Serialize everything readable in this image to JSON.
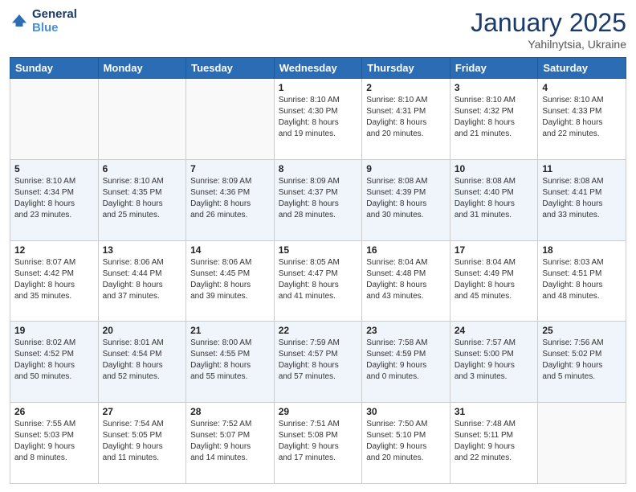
{
  "header": {
    "logo_line1": "General",
    "logo_line2": "Blue",
    "month": "January 2025",
    "location": "Yahilnytsia, Ukraine"
  },
  "weekdays": [
    "Sunday",
    "Monday",
    "Tuesday",
    "Wednesday",
    "Thursday",
    "Friday",
    "Saturday"
  ],
  "weeks": [
    [
      {
        "day": "",
        "info": ""
      },
      {
        "day": "",
        "info": ""
      },
      {
        "day": "",
        "info": ""
      },
      {
        "day": "1",
        "info": "Sunrise: 8:10 AM\nSunset: 4:30 PM\nDaylight: 8 hours\nand 19 minutes."
      },
      {
        "day": "2",
        "info": "Sunrise: 8:10 AM\nSunset: 4:31 PM\nDaylight: 8 hours\nand 20 minutes."
      },
      {
        "day": "3",
        "info": "Sunrise: 8:10 AM\nSunset: 4:32 PM\nDaylight: 8 hours\nand 21 minutes."
      },
      {
        "day": "4",
        "info": "Sunrise: 8:10 AM\nSunset: 4:33 PM\nDaylight: 8 hours\nand 22 minutes."
      }
    ],
    [
      {
        "day": "5",
        "info": "Sunrise: 8:10 AM\nSunset: 4:34 PM\nDaylight: 8 hours\nand 23 minutes."
      },
      {
        "day": "6",
        "info": "Sunrise: 8:10 AM\nSunset: 4:35 PM\nDaylight: 8 hours\nand 25 minutes."
      },
      {
        "day": "7",
        "info": "Sunrise: 8:09 AM\nSunset: 4:36 PM\nDaylight: 8 hours\nand 26 minutes."
      },
      {
        "day": "8",
        "info": "Sunrise: 8:09 AM\nSunset: 4:37 PM\nDaylight: 8 hours\nand 28 minutes."
      },
      {
        "day": "9",
        "info": "Sunrise: 8:08 AM\nSunset: 4:39 PM\nDaylight: 8 hours\nand 30 minutes."
      },
      {
        "day": "10",
        "info": "Sunrise: 8:08 AM\nSunset: 4:40 PM\nDaylight: 8 hours\nand 31 minutes."
      },
      {
        "day": "11",
        "info": "Sunrise: 8:08 AM\nSunset: 4:41 PM\nDaylight: 8 hours\nand 33 minutes."
      }
    ],
    [
      {
        "day": "12",
        "info": "Sunrise: 8:07 AM\nSunset: 4:42 PM\nDaylight: 8 hours\nand 35 minutes."
      },
      {
        "day": "13",
        "info": "Sunrise: 8:06 AM\nSunset: 4:44 PM\nDaylight: 8 hours\nand 37 minutes."
      },
      {
        "day": "14",
        "info": "Sunrise: 8:06 AM\nSunset: 4:45 PM\nDaylight: 8 hours\nand 39 minutes."
      },
      {
        "day": "15",
        "info": "Sunrise: 8:05 AM\nSunset: 4:47 PM\nDaylight: 8 hours\nand 41 minutes."
      },
      {
        "day": "16",
        "info": "Sunrise: 8:04 AM\nSunset: 4:48 PM\nDaylight: 8 hours\nand 43 minutes."
      },
      {
        "day": "17",
        "info": "Sunrise: 8:04 AM\nSunset: 4:49 PM\nDaylight: 8 hours\nand 45 minutes."
      },
      {
        "day": "18",
        "info": "Sunrise: 8:03 AM\nSunset: 4:51 PM\nDaylight: 8 hours\nand 48 minutes."
      }
    ],
    [
      {
        "day": "19",
        "info": "Sunrise: 8:02 AM\nSunset: 4:52 PM\nDaylight: 8 hours\nand 50 minutes."
      },
      {
        "day": "20",
        "info": "Sunrise: 8:01 AM\nSunset: 4:54 PM\nDaylight: 8 hours\nand 52 minutes."
      },
      {
        "day": "21",
        "info": "Sunrise: 8:00 AM\nSunset: 4:55 PM\nDaylight: 8 hours\nand 55 minutes."
      },
      {
        "day": "22",
        "info": "Sunrise: 7:59 AM\nSunset: 4:57 PM\nDaylight: 8 hours\nand 57 minutes."
      },
      {
        "day": "23",
        "info": "Sunrise: 7:58 AM\nSunset: 4:59 PM\nDaylight: 9 hours\nand 0 minutes."
      },
      {
        "day": "24",
        "info": "Sunrise: 7:57 AM\nSunset: 5:00 PM\nDaylight: 9 hours\nand 3 minutes."
      },
      {
        "day": "25",
        "info": "Sunrise: 7:56 AM\nSunset: 5:02 PM\nDaylight: 9 hours\nand 5 minutes."
      }
    ],
    [
      {
        "day": "26",
        "info": "Sunrise: 7:55 AM\nSunset: 5:03 PM\nDaylight: 9 hours\nand 8 minutes."
      },
      {
        "day": "27",
        "info": "Sunrise: 7:54 AM\nSunset: 5:05 PM\nDaylight: 9 hours\nand 11 minutes."
      },
      {
        "day": "28",
        "info": "Sunrise: 7:52 AM\nSunset: 5:07 PM\nDaylight: 9 hours\nand 14 minutes."
      },
      {
        "day": "29",
        "info": "Sunrise: 7:51 AM\nSunset: 5:08 PM\nDaylight: 9 hours\nand 17 minutes."
      },
      {
        "day": "30",
        "info": "Sunrise: 7:50 AM\nSunset: 5:10 PM\nDaylight: 9 hours\nand 20 minutes."
      },
      {
        "day": "31",
        "info": "Sunrise: 7:48 AM\nSunset: 5:11 PM\nDaylight: 9 hours\nand 22 minutes."
      },
      {
        "day": "",
        "info": ""
      }
    ]
  ]
}
